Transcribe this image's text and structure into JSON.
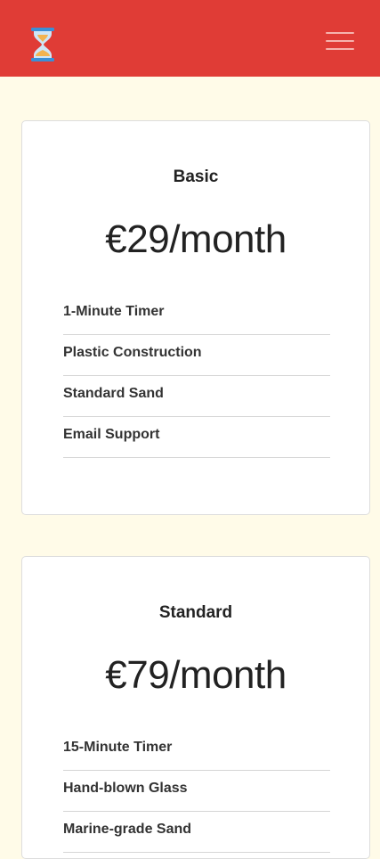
{
  "header": {
    "logo_icon": "hourglass-icon",
    "menu_icon": "hamburger-menu-icon",
    "brand_color": "#e03c36"
  },
  "plans": [
    {
      "name": "Basic",
      "price": "€29/month",
      "features": [
        "1-Minute Timer",
        "Plastic Construction",
        "Standard Sand",
        "Email Support"
      ]
    },
    {
      "name": "Standard",
      "price": "€79/month",
      "features": [
        "15-Minute Timer",
        "Hand-blown Glass",
        "Marine-grade Sand"
      ]
    }
  ]
}
